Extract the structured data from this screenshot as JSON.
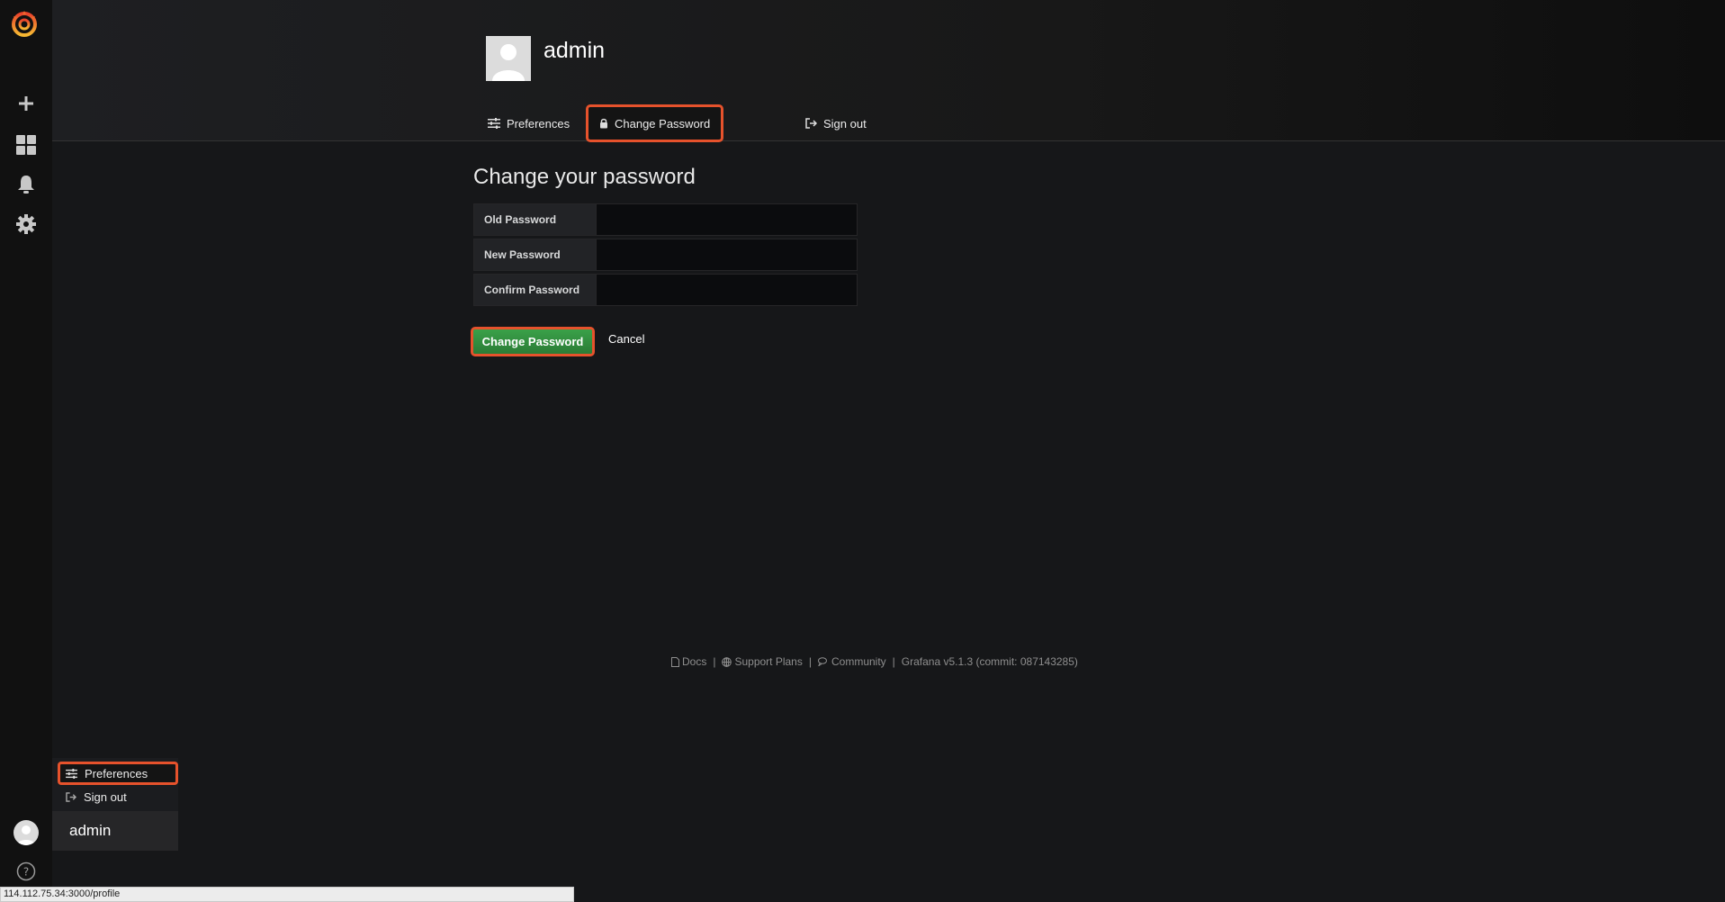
{
  "sidebar": {
    "items": [
      {
        "name": "create",
        "icon": "plus-icon"
      },
      {
        "name": "dashboards",
        "icon": "grid-icon"
      },
      {
        "name": "alerting",
        "icon": "bell-icon"
      },
      {
        "name": "configuration",
        "icon": "gear-icon"
      }
    ],
    "help_icon": "help-icon"
  },
  "header": {
    "title": "admin",
    "tabs": [
      {
        "label": "Preferences",
        "icon": "sliders-icon",
        "active": false
      },
      {
        "label": "Change Password",
        "icon": "lock-icon",
        "active": true
      },
      {
        "label": "Sign out",
        "icon": "sign-out-icon",
        "active": false
      }
    ]
  },
  "form": {
    "title": "Change your password",
    "fields": [
      {
        "label": "Old Password",
        "value": ""
      },
      {
        "label": "New Password",
        "value": ""
      },
      {
        "label": "Confirm Password",
        "value": ""
      }
    ],
    "submit_label": "Change Password",
    "cancel_label": "Cancel"
  },
  "footer": {
    "docs": "Docs",
    "support": "Support Plans",
    "community": "Community",
    "version": "Grafana v5.1.3 (commit: 087143285)"
  },
  "profile_menu": {
    "items": [
      {
        "label": "Preferences",
        "icon": "sliders-icon"
      },
      {
        "label": "Sign out",
        "icon": "sign-out-icon"
      }
    ],
    "user": "admin"
  },
  "statusbar": {
    "url": "114.112.75.34:3000/profile"
  },
  "colors": {
    "highlight": "#e6522c",
    "primary_button": "#2f8e3a",
    "background": "#161719",
    "sidebar": "#111111"
  }
}
